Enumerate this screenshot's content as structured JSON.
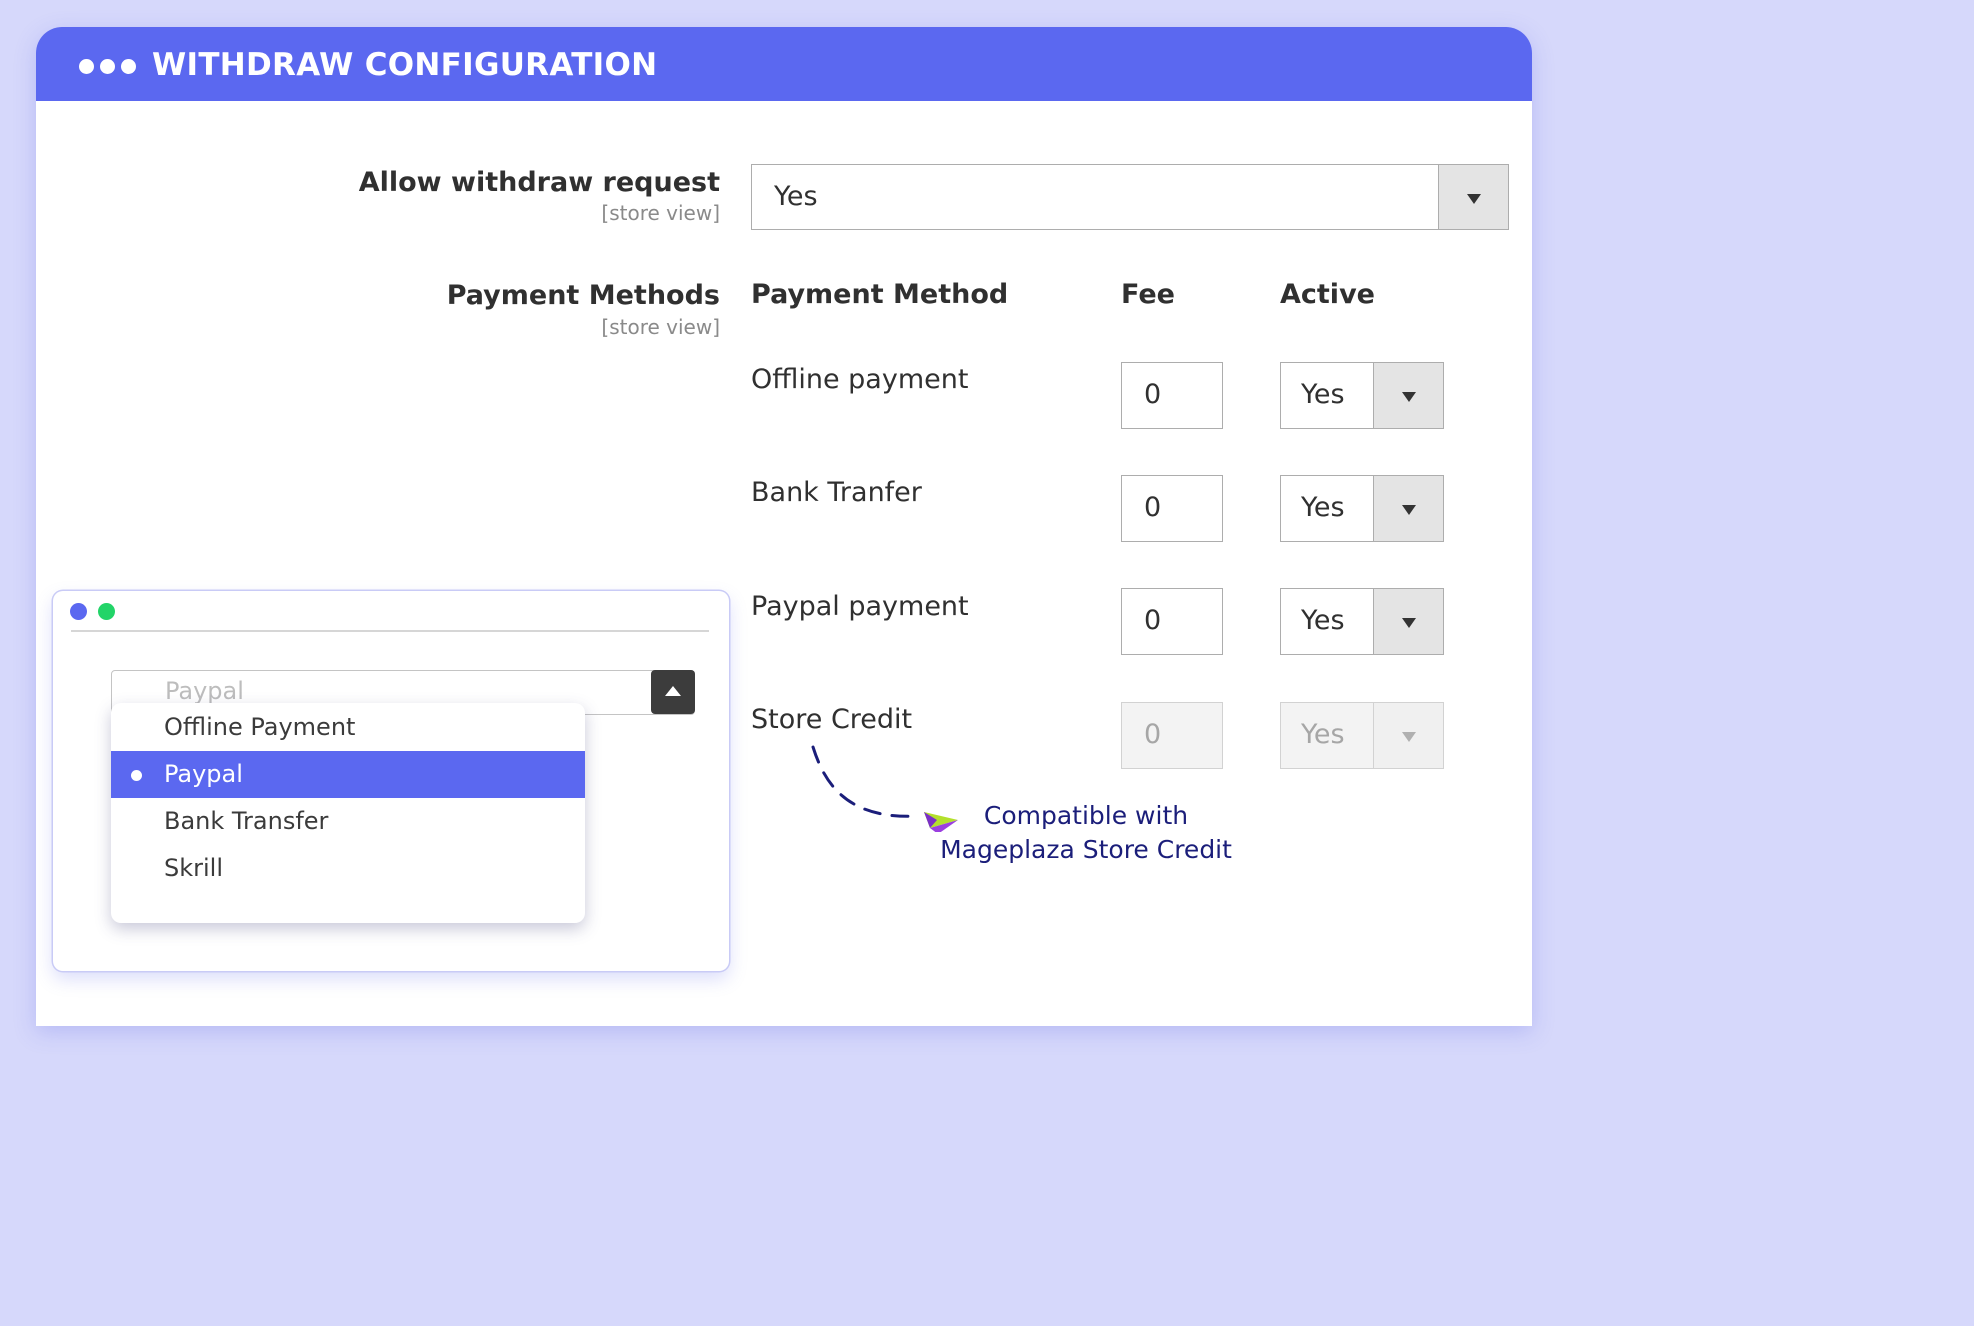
{
  "header": {
    "title": "WITHDRAW CONFIGURATION"
  },
  "allow_withdraw": {
    "label": "Allow withdraw request",
    "scope": "[store view]",
    "value": "Yes"
  },
  "payment_methods": {
    "label": "Payment Methods",
    "scope": "[store view]",
    "columns": {
      "method": "Payment Method",
      "fee": "Fee",
      "active": "Active"
    },
    "rows": [
      {
        "name": "Offline payment",
        "fee": "0",
        "active": "Yes",
        "disabled": false
      },
      {
        "name": "Bank Tranfer",
        "fee": "0",
        "active": "Yes",
        "disabled": false
      },
      {
        "name": "Paypal payment",
        "fee": "0",
        "active": "Yes",
        "disabled": false
      },
      {
        "name": "Store Credit",
        "fee": "0",
        "active": "Yes",
        "disabled": true
      }
    ]
  },
  "note": {
    "line1": "Compatible with",
    "line2": "Mageplaza Store Credit"
  },
  "mini_window": {
    "select_value": "Paypal",
    "options": [
      {
        "label": "Offline Payment",
        "selected": false
      },
      {
        "label": "Paypal",
        "selected": true
      },
      {
        "label": "Bank Transfer",
        "selected": false
      },
      {
        "label": "Skrill",
        "selected": false
      }
    ]
  },
  "colors": {
    "accent": "#5b68f0",
    "background": "#d6d8fb",
    "note_text": "#1b1e7a",
    "window_dot_blue": "#5b68f0",
    "window_dot_green": "#22d468"
  }
}
